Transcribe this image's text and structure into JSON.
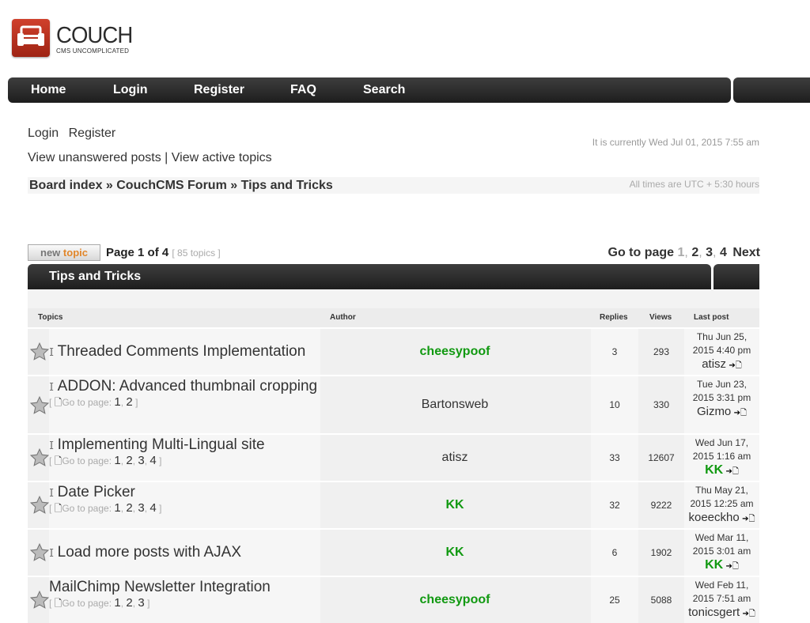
{
  "logo": {
    "title": "COUCH",
    "tagline": "CMS UNCOMPLICATED"
  },
  "nav": [
    {
      "label": "Home"
    },
    {
      "label": "Login"
    },
    {
      "label": "Register"
    },
    {
      "label": "FAQ"
    },
    {
      "label": "Search"
    }
  ],
  "toplinks": {
    "login": "Login",
    "register": "Register"
  },
  "viewlinks": {
    "unanswered": "View unanswered posts",
    "separator": "|",
    "active": "View active topics"
  },
  "current_time": "It is currently Wed Jul 01, 2015 7:55 am",
  "breadcrumb": "Board index » CouchCMS Forum » Tips and Tricks",
  "timezone": "All times are UTC + 5:30 hours",
  "new_topic": {
    "word1": "new",
    "word2": "topic"
  },
  "page_info": {
    "label": "Page 1 of 4",
    "count": "[ 85 topics ]"
  },
  "goto_page": {
    "label": "Go to page",
    "pages": [
      "1",
      "2",
      "3",
      "4"
    ],
    "next": "Next"
  },
  "forum_title": "Tips and Tricks",
  "columns": {
    "topics": "Topics",
    "author": "Author",
    "replies": "Replies",
    "views": "Views",
    "last_post": "Last post"
  },
  "goto_label": "Go to page:",
  "topics": [
    {
      "title": "Threaded Comments Implementation",
      "author": "cheesypoof",
      "author_green": true,
      "replies": "3",
      "views": "293",
      "last_date": "Thu Jun 25,",
      "last_time": "2015 4:40 pm",
      "last_user": "atisz",
      "last_green": false,
      "pages": []
    },
    {
      "title": "ADDON: Advanced thumbnail cropping",
      "author": "Bartonsweb",
      "author_green": false,
      "replies": "10",
      "views": "330",
      "last_date": "Tue Jun 23,",
      "last_time": "2015 3:31 pm",
      "last_user": "Gizmo",
      "last_green": false,
      "pages": [
        "1",
        "2"
      ]
    },
    {
      "title": "Implementing Multi-Lingual site",
      "author": "atisz",
      "author_green": false,
      "replies": "33",
      "views": "12607",
      "last_date": "Wed Jun 17,",
      "last_time": "2015 1:16 am",
      "last_user": "KK",
      "last_green": true,
      "pages": [
        "1",
        "2",
        "3",
        "4"
      ]
    },
    {
      "title": "Date Picker",
      "author": "KK",
      "author_green": true,
      "replies": "32",
      "views": "9222",
      "last_date": "Thu May 21,",
      "last_time": "2015 12:25 am",
      "last_user": "koeeckho",
      "last_green": false,
      "pages": [
        "1",
        "2",
        "3",
        "4"
      ]
    },
    {
      "title": "Load more posts with AJAX",
      "author": "KK",
      "author_green": true,
      "replies": "6",
      "views": "1902",
      "last_date": "Wed Mar 11,",
      "last_time": "2015 3:01 am",
      "last_user": "KK",
      "last_green": true,
      "pages": []
    },
    {
      "title": "MailChimp Newsletter Integration",
      "author": "cheesypoof",
      "author_green": true,
      "replies": "25",
      "views": "5088",
      "last_date": "Wed Feb 11,",
      "last_time": "2015 7:51 am",
      "last_user": "tonicsgert",
      "last_green": false,
      "pages": [
        "1",
        "2",
        "3"
      ]
    }
  ]
}
